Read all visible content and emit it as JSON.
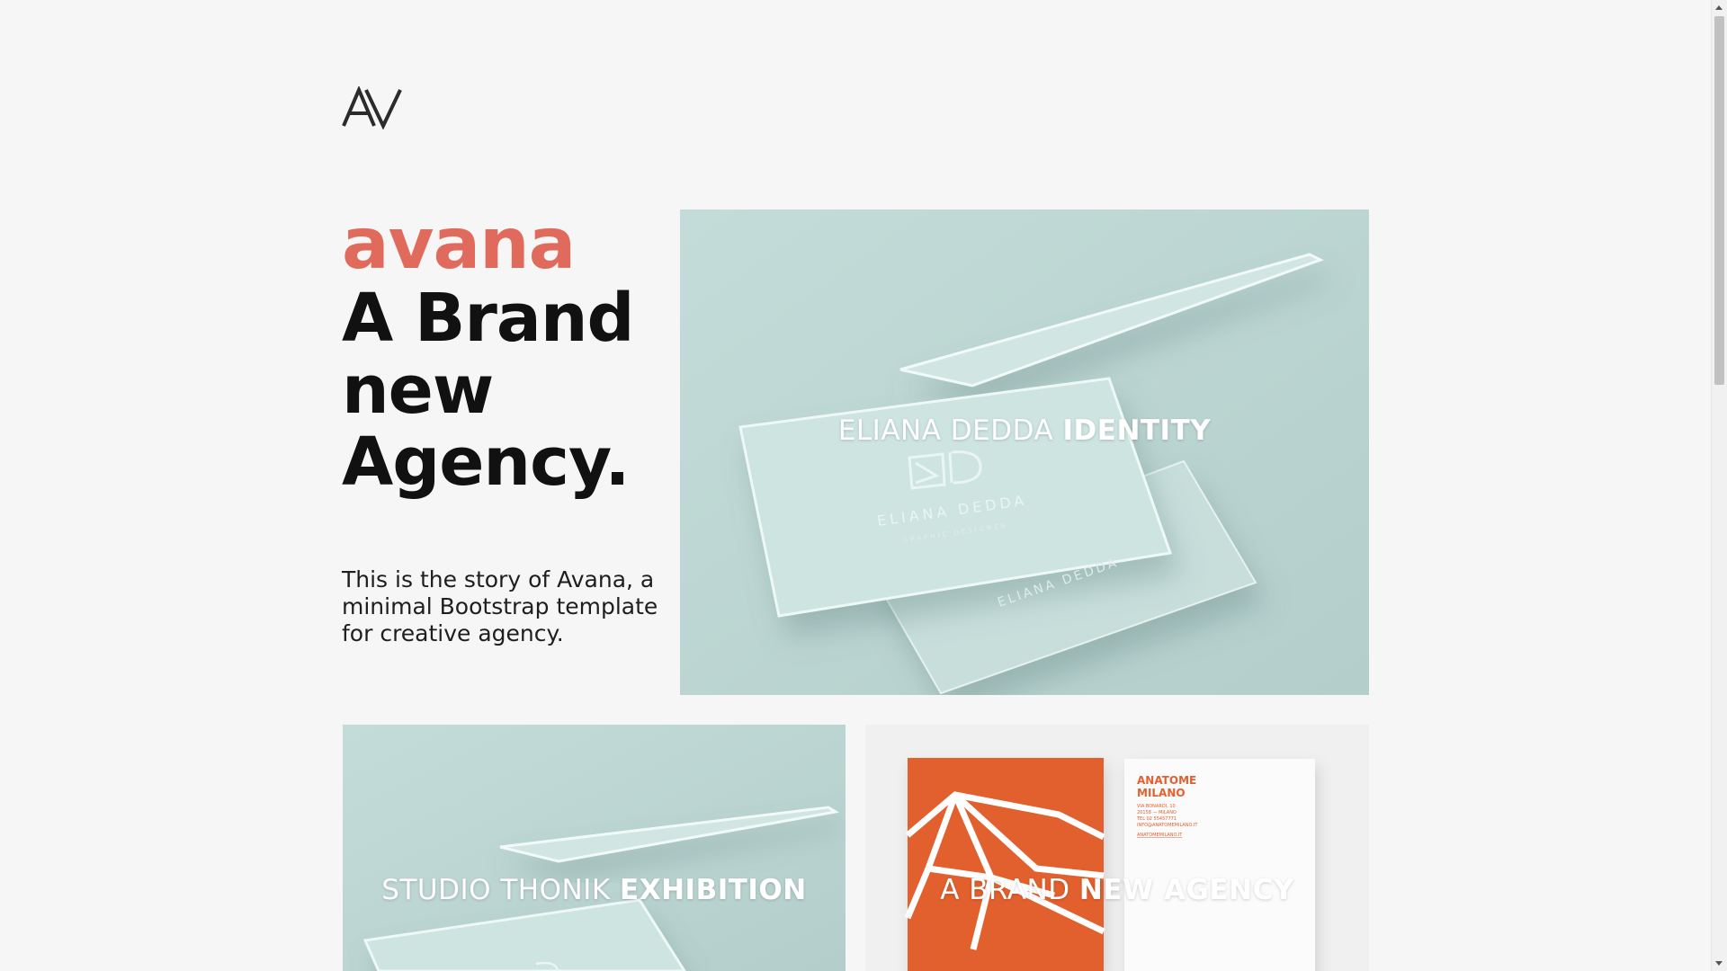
{
  "logo": {
    "text": "AV",
    "icon": "av-monogram-logo"
  },
  "hero": {
    "brand": "avana",
    "headline": [
      "A Brand",
      "new",
      "Agency."
    ],
    "story": "This is the story of Avana, a minimal Bootstrap template for creative agency."
  },
  "projects": [
    {
      "title_light": "ELIANA DEDDA ",
      "title_bold": "IDENTITY",
      "image": "business-card-mockup"
    },
    {
      "title_light": "STUDIO THONIK ",
      "title_bold": "EXHIBITION",
      "image": "business-card-mockup"
    },
    {
      "title_light": "A BRAND ",
      "title_bold": "NEW AGENCY",
      "image": "anatome-milano-stationery"
    }
  ],
  "stationery": {
    "name": "ANATOME\nMILANO",
    "address": [
      "VIA BONARDI, 10",
      "20158 — MILANO",
      "TEL 02 55457771",
      "INFO@ANATOMEMILANO.IT"
    ],
    "web": "ANATOMEMILANO.IT"
  },
  "card_print": {
    "name": "ELIANA DEDDA",
    "sub": "GRAPHIC DESIGNER"
  },
  "colors": {
    "accent": "#e06b5c",
    "mint": "#bdd6d3",
    "orange": "#e2602f",
    "background": "#f6f6f6"
  }
}
